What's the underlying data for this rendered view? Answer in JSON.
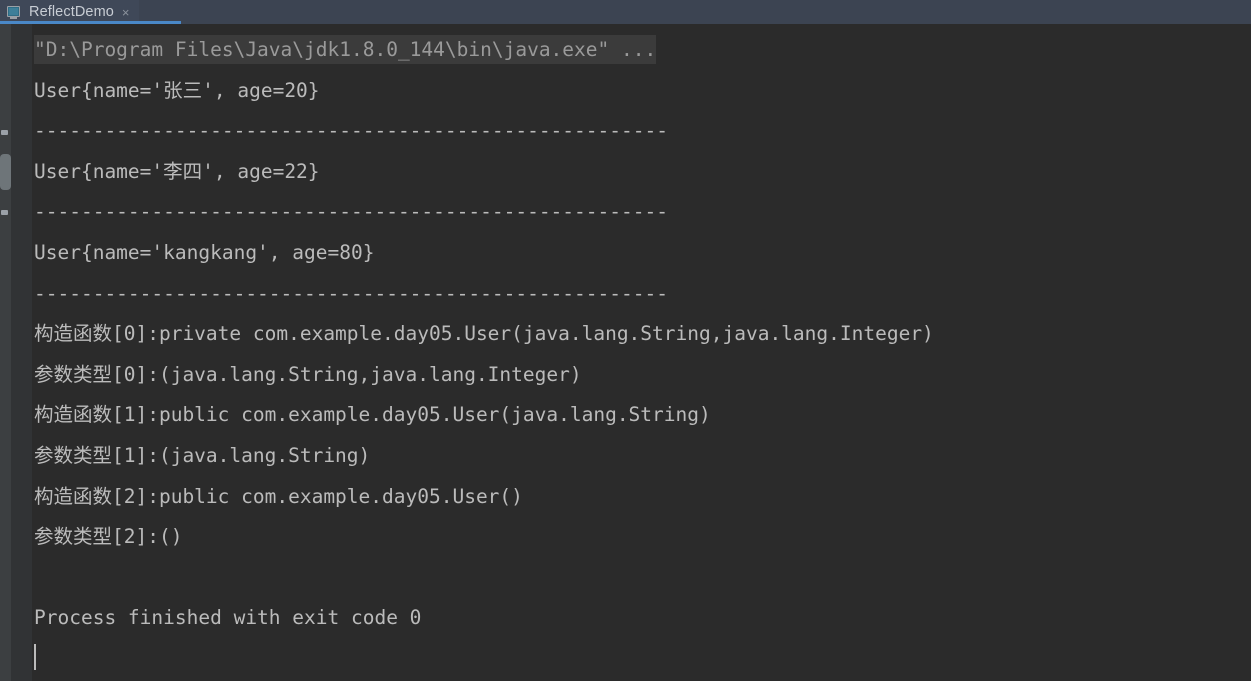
{
  "window": {
    "tab": {
      "label": "ReflectDemo",
      "close_label": "×",
      "icon": "console-run-icon",
      "accent_color": "#4a88c7"
    }
  },
  "console": {
    "background_color": "#2b2b2b",
    "text_color": "#bbbbbb",
    "command_text_color": "#9a9a9a",
    "command_line": "\"D:\\Program Files\\Java\\jdk1.8.0_144\\bin\\java.exe\" ...",
    "separator": "------------------------------------------------------",
    "lines": [
      "User{name='张三', age=20}",
      "------------------------------------------------------",
      "User{name='李四', age=22}",
      "------------------------------------------------------",
      "User{name='kangkang', age=80}",
      "------------------------------------------------------",
      "构造函数[0]:private com.example.day05.User(java.lang.String,java.lang.Integer)",
      "参数类型[0]:(java.lang.String,java.lang.Integer)",
      "构造函数[1]:public com.example.day05.User(java.lang.String)",
      "参数类型[1]:(java.lang.String)",
      "构造函数[2]:public com.example.day05.User()",
      "参数类型[2]:()",
      "",
      "Process finished with exit code 0"
    ]
  }
}
